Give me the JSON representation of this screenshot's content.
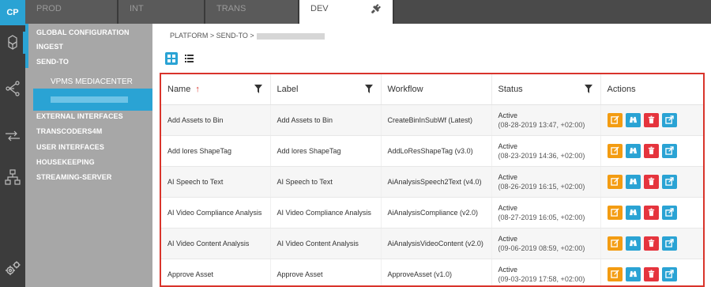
{
  "app": {
    "logo_text": "CP"
  },
  "rail_icons": [
    "cubes-icon",
    "network-icon",
    "transfer-icon",
    "hierarchy-icon",
    "gears-icon"
  ],
  "env_tabs": [
    {
      "label": "PROD",
      "active": false
    },
    {
      "label": "INT",
      "active": false
    },
    {
      "label": "TRANS",
      "active": false
    },
    {
      "label": "DEV",
      "active": true,
      "icon": "plug-icon"
    }
  ],
  "sidebar": {
    "items": [
      {
        "label": "GLOBAL CONFIGURATION"
      },
      {
        "label": "INGEST"
      },
      {
        "label": "SEND-TO"
      },
      {
        "label": "VPMS MEDIACENTER"
      },
      {
        "label": "EXTERNAL INTERFACES"
      },
      {
        "label": "TRANSCODERS4M"
      },
      {
        "label": "USER INTERFACES"
      },
      {
        "label": "HOUSEKEEPING"
      },
      {
        "label": "STREAMING-SERVER"
      }
    ]
  },
  "breadcrumb": "PLATFORM > SEND-TO >",
  "view_toggle": {
    "grid": "grid-view-icon",
    "list": "list-view-icon"
  },
  "table": {
    "columns": [
      "Name",
      "Label",
      "Workflow",
      "Status",
      "Actions"
    ],
    "sort_indicator": "↑",
    "rows": [
      {
        "name": "Add Assets to Bin",
        "label": "Add Assets to Bin",
        "workflow": "CreateBinInSubWf (Latest)",
        "status": "Active",
        "status_date": "(08-28-2019 13:47, +02:00)"
      },
      {
        "name": "Add lores ShapeTag",
        "label": "Add lores ShapeTag",
        "workflow": "AddLoResShapeTag (v3.0)",
        "status": "Active",
        "status_date": "(08-23-2019 14:36, +02:00)"
      },
      {
        "name": "AI Speech to Text",
        "label": "AI Speech to Text",
        "workflow": "AiAnalysisSpeech2Text (v4.0)",
        "status": "Active",
        "status_date": "(08-26-2019 16:15, +02:00)"
      },
      {
        "name": "AI Video Compliance Analysis",
        "label": "AI Video Compliance Analysis",
        "workflow": "AiAnalysisCompliance (v2.0)",
        "status": "Active",
        "status_date": "(08-27-2019 16:05, +02:00)"
      },
      {
        "name": "AI Video Content Analysis",
        "label": "AI Video Content Analysis",
        "workflow": "AiAnalysisVideoContent (v2.0)",
        "status": "Active",
        "status_date": "(09-06-2019 08:59, +02:00)"
      },
      {
        "name": "Approve Asset",
        "label": "Approve Asset",
        "workflow": "ApproveAsset (v1.0)",
        "status": "Active",
        "status_date": "(09-03-2019 17:58, +02:00)"
      }
    ]
  },
  "colors": {
    "accent": "#2aa3d4",
    "edit": "#f39c12",
    "delete": "#e5343d",
    "highlight_border": "#d9342b"
  }
}
